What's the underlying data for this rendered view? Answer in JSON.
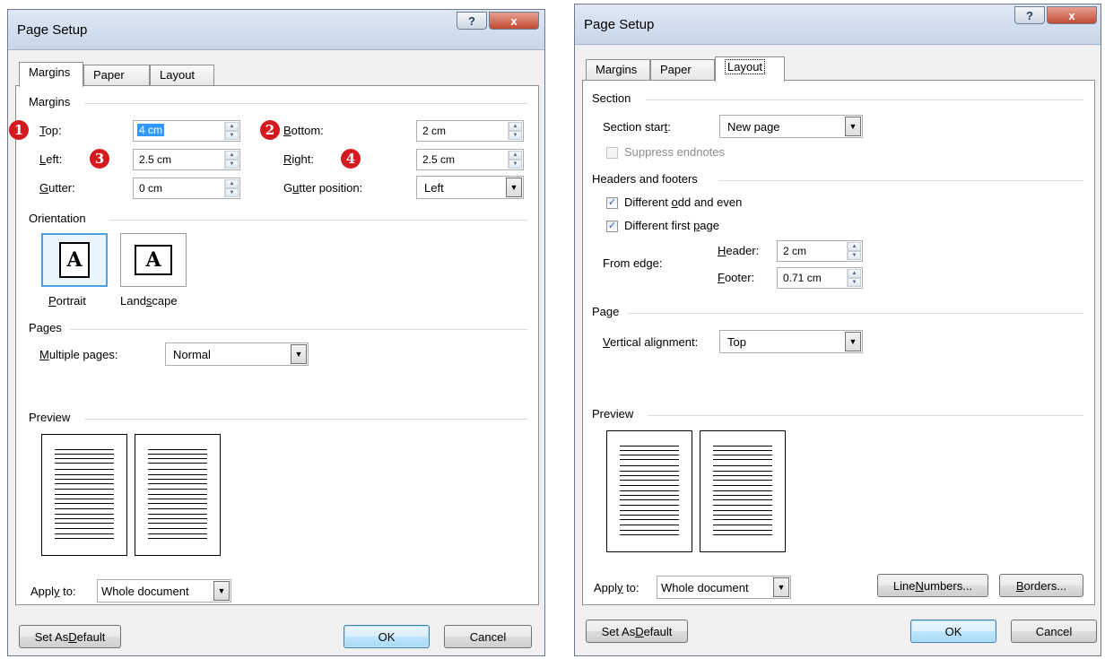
{
  "dialog_left": {
    "title": "Page Setup",
    "help_glyph": "?",
    "close_glyph": "x",
    "tabs": [
      {
        "label": "Margins",
        "active": true
      },
      {
        "label": "Paper",
        "active": false
      },
      {
        "label": "Layout",
        "active": false
      }
    ],
    "margins": {
      "group_label": "Margins",
      "top_label": "Top:",
      "top_value": "4 cm",
      "bottom_label": "Bottom:",
      "bottom_value": "2 cm",
      "left_label": "Left:",
      "left_value": "2.5 cm",
      "right_label": "Right:",
      "right_value": "2.5 cm",
      "gutter_label": "Gutter:",
      "gutter_value": "0 cm",
      "gutter_pos_label": "Gutter position:",
      "gutter_pos_value": "Left"
    },
    "badges": [
      "1",
      "2",
      "3",
      "4"
    ],
    "badge_color": "#d4191f",
    "orientation": {
      "group_label": "Orientation",
      "portrait_label": "Portrait",
      "landscape_label": "Landscape",
      "glyph": "A",
      "selected": "Portrait"
    },
    "pages": {
      "group_label": "Pages",
      "multiple_label": "Multiple pages:",
      "multiple_value": "Normal"
    },
    "preview": {
      "group_label": "Preview"
    },
    "apply_to": {
      "label": "Apply to:",
      "value": "Whole document"
    },
    "buttons": {
      "set_default": "Set As Default",
      "ok": "OK",
      "cancel": "Cancel"
    }
  },
  "dialog_right": {
    "title": "Page Setup",
    "help_glyph": "?",
    "close_glyph": "x",
    "tabs": [
      {
        "label": "Margins",
        "active": false
      },
      {
        "label": "Paper",
        "active": false
      },
      {
        "label": "Layout",
        "active": true
      }
    ],
    "section": {
      "group_label": "Section",
      "start_label": "Section start:",
      "start_value": "New page",
      "suppress_label": "Suppress endnotes",
      "suppress_checked": false,
      "suppress_enabled": false
    },
    "headers_footers": {
      "group_label": "Headers and footers",
      "odd_even_label": "Different odd and even",
      "odd_even_checked": true,
      "first_page_label": "Different first page",
      "first_page_checked": true,
      "from_edge_label": "From edge:",
      "header_label": "Header:",
      "header_value": "2 cm",
      "footer_label": "Footer:",
      "footer_value": "0.71 cm"
    },
    "page": {
      "group_label": "Page",
      "valign_label": "Vertical alignment:",
      "valign_value": "Top"
    },
    "preview": {
      "group_label": "Preview"
    },
    "apply_to": {
      "label": "Apply to:",
      "value": "Whole document"
    },
    "buttons": {
      "line_numbers": "Line Numbers...",
      "borders": "Borders...",
      "set_default": "Set As Default",
      "ok": "OK",
      "cancel": "Cancel"
    }
  },
  "icons": {
    "spin_up": "up-arrow-icon",
    "spin_down": "down-arrow-icon",
    "dropdown": "chevron-down-icon",
    "check": "checkmark-icon",
    "help": "help-icon",
    "close": "close-icon"
  }
}
